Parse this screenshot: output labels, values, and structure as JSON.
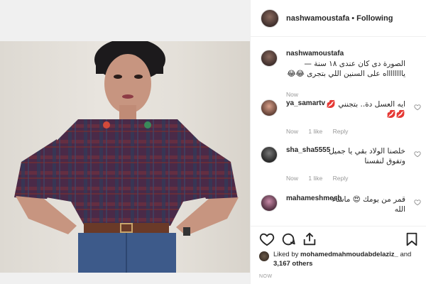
{
  "post": {
    "username": "nashwamoustafa",
    "separator": "•",
    "follow_status": "Following"
  },
  "caption": {
    "username": "nashwamoustafa",
    "text": "الصورة دى كان عندى ١٨ سنة — يااااااااه على السنين اللي بتجرى 😂😂",
    "time": "Now"
  },
  "comments": [
    {
      "username": "ya_samartv",
      "text": "ايه العسل دة.. بتجنني 💋💋💋",
      "time": "Now",
      "likes": "1 like",
      "reply": "Reply"
    },
    {
      "username": "sha_sha5555",
      "text": "خلصنا الولاد بقي يا جميل وتفوق لنفسنا",
      "time": "Now",
      "likes": "1 like",
      "reply": "Reply"
    },
    {
      "username": "mahameshmesh",
      "text": "قمر من يومك 😍 ماشاء الله",
      "time": "",
      "likes": "",
      "reply": ""
    }
  ],
  "likes": {
    "prefix": "Liked by",
    "first_user": "mohamedmahmoudabdelaziz_",
    "conjunction": "and",
    "others": "3,167 others"
  },
  "timestamp": "NOW",
  "icons": [
    "heart-icon",
    "comment-icon",
    "share-icon",
    "bookmark-icon"
  ],
  "colors": {
    "link": "#262626",
    "muted": "#999999",
    "border": "#efefef"
  }
}
